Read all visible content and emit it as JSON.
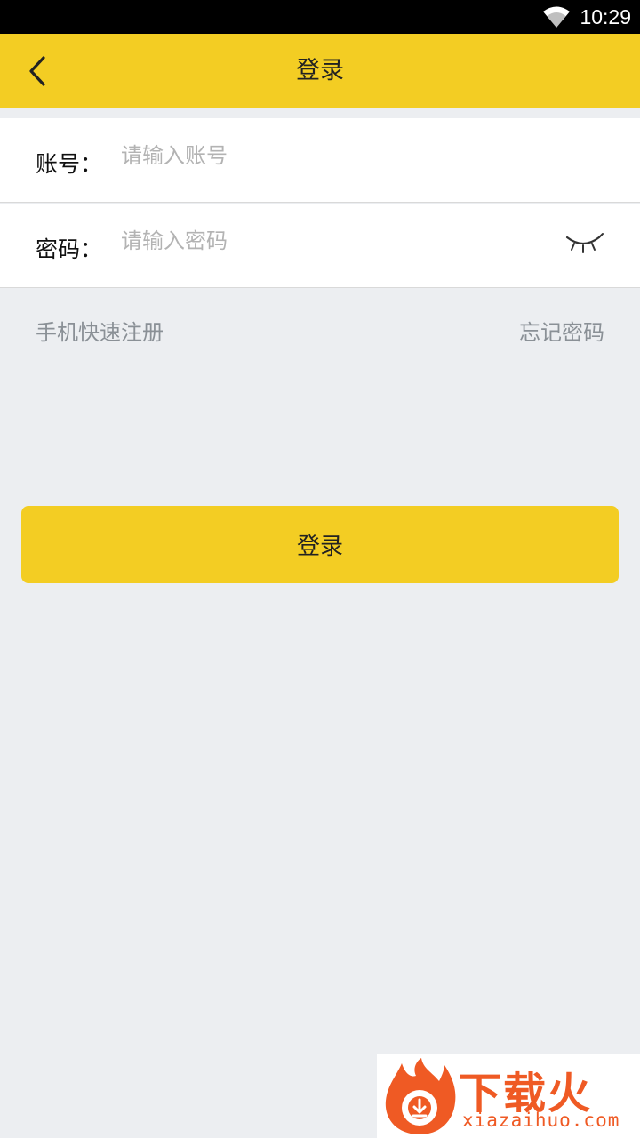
{
  "status_bar": {
    "wifi_icon": "wifi-icon",
    "time": "10:29"
  },
  "app_bar": {
    "back_icon": "chevron-left-icon",
    "title": "登录",
    "color": "#f3cd23"
  },
  "form": {
    "account": {
      "label": "账号：",
      "value": "",
      "placeholder": "请输入账号"
    },
    "password": {
      "label": "密码：",
      "value": "",
      "placeholder": "请输入密码",
      "toggle_icon": "eye-closed-icon"
    }
  },
  "links": {
    "register": "手机快速注册",
    "forgot_password": "忘记密码"
  },
  "login_button": {
    "label": "登录"
  },
  "watermark": {
    "logo_icon": "flame-download-logo",
    "cn_text": "下载火",
    "en_text": "xiazaihuo.com",
    "color": "#ef5a24"
  }
}
